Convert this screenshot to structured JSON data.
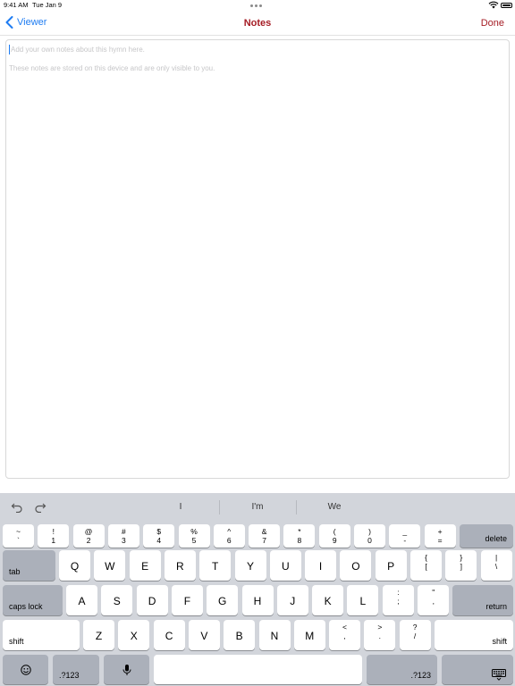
{
  "status": {
    "time": "9:41 AM",
    "date": "Tue Jan 9"
  },
  "nav": {
    "back_label": "Viewer",
    "title": "Notes",
    "done_label": "Done"
  },
  "notes": {
    "placeholder_line1": "Add your own notes about this hymn here.",
    "placeholder_line2": "These notes are stored on this device and are only visible to you."
  },
  "keyboard": {
    "suggestions": [
      "I",
      "I'm",
      "We"
    ],
    "row1": [
      {
        "top": "~",
        "bottom": "`"
      },
      {
        "top": "!",
        "bottom": "1"
      },
      {
        "top": "@",
        "bottom": "2"
      },
      {
        "top": "#",
        "bottom": "3"
      },
      {
        "top": "$",
        "bottom": "4"
      },
      {
        "top": "%",
        "bottom": "5"
      },
      {
        "top": "^",
        "bottom": "6"
      },
      {
        "top": "&",
        "bottom": "7"
      },
      {
        "top": "*",
        "bottom": "8"
      },
      {
        "top": "(",
        "bottom": "9"
      },
      {
        "top": ")",
        "bottom": "0"
      },
      {
        "top": "_",
        "bottom": "-"
      },
      {
        "top": "+",
        "bottom": "="
      }
    ],
    "delete_label": "delete",
    "tab_label": "tab",
    "row2": [
      "Q",
      "W",
      "E",
      "R",
      "T",
      "Y",
      "U",
      "I",
      "O",
      "P"
    ],
    "row2_extra": [
      {
        "top": "{",
        "bottom": "["
      },
      {
        "top": "}",
        "bottom": "]"
      },
      {
        "top": "|",
        "bottom": "\\"
      }
    ],
    "caps_label": "caps lock",
    "row3": [
      "A",
      "S",
      "D",
      "F",
      "G",
      "H",
      "J",
      "K",
      "L"
    ],
    "row3_extra": [
      {
        "top": ":",
        "bottom": ";"
      },
      {
        "top": "\"",
        "bottom": ","
      }
    ],
    "return_label": "return",
    "shift_label": "shift",
    "row4": [
      "Z",
      "X",
      "C",
      "V",
      "B",
      "N",
      "M"
    ],
    "row4_extra": [
      {
        "top": "<",
        "bottom": ","
      },
      {
        "top": ">",
        "bottom": "."
      },
      {
        "top": "?",
        "bottom": "/"
      }
    ],
    "numbers_label": ".?123"
  },
  "colors": {
    "accent_blue": "#1e7cf2",
    "title_red": "#a51c24",
    "keyboard_bg": "#d2d5db"
  }
}
